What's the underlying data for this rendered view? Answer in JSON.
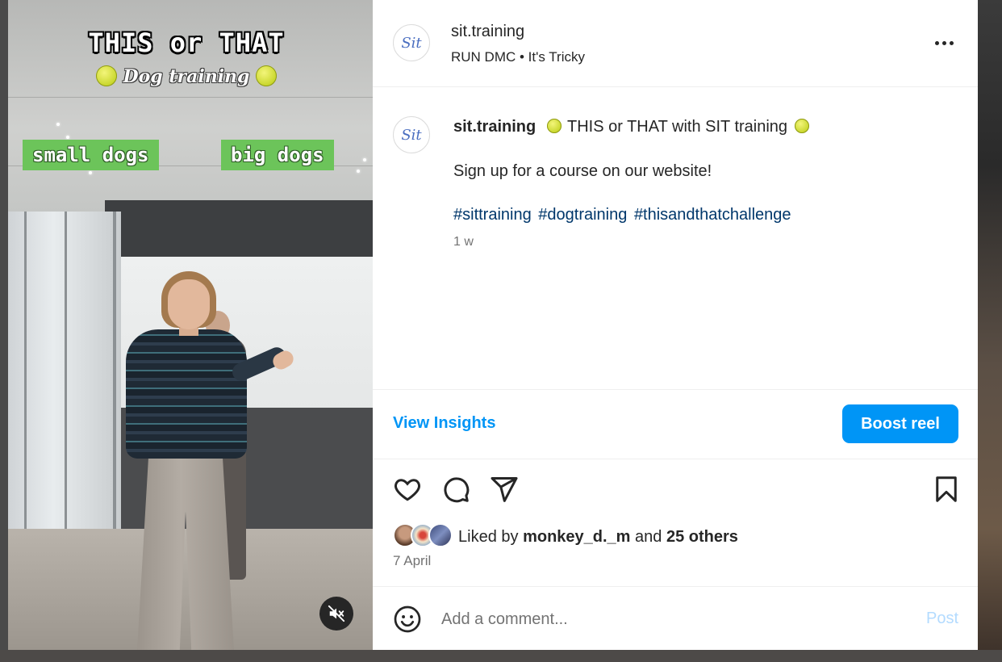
{
  "video": {
    "overlay_title": "THIS or THAT",
    "overlay_subtitle": "Dog training",
    "tag_left": "small dogs",
    "tag_right": "big dogs",
    "mute_icon": "speaker-muted-icon"
  },
  "post": {
    "avatar_text": "Sit",
    "username": "sit.training",
    "music": "RUN DMC • It's Tricky",
    "caption": {
      "username": "sit.training",
      "text": "THIS or THAT with SIT training",
      "body": "Sign up for a course on our website!",
      "hashtags": [
        "#sittraining",
        "#dogtraining",
        "#thisandthatchallenge"
      ],
      "time": "1 w"
    },
    "insights_label": "View Insights",
    "boost_label": "Boost reel",
    "likes": {
      "prefix": "Liked by",
      "user": "monkey_d._m",
      "conjunction": "and",
      "others": "25 others"
    },
    "date": "7 April",
    "comment_placeholder": "Add a comment...",
    "post_label": "Post"
  },
  "colors": {
    "accent": "#0095f6",
    "tag_green": "#6cc45a",
    "hashtag": "#00376b",
    "muted_text": "#737373"
  }
}
